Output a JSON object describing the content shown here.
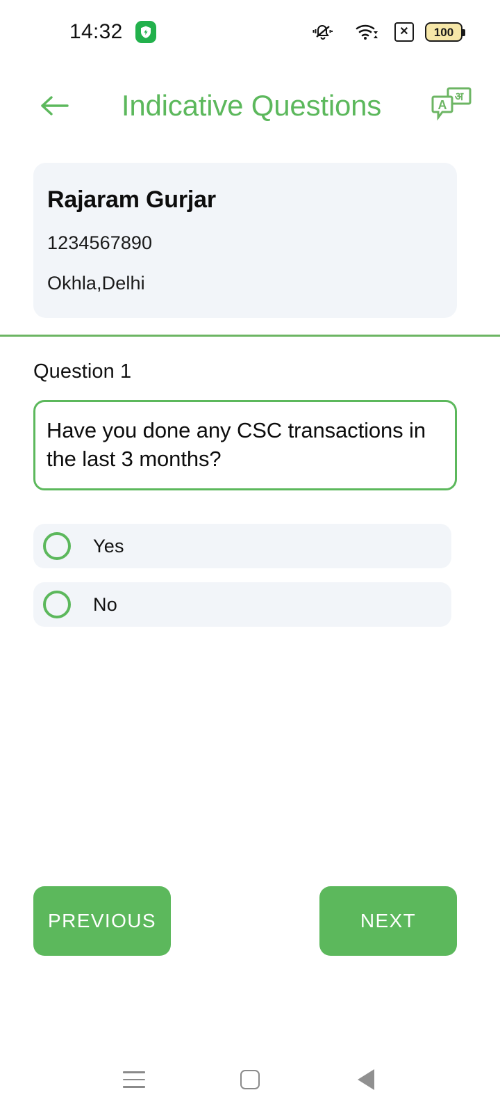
{
  "status_bar": {
    "time": "14:32",
    "shield_icon": "shield-bolt-icon",
    "mute_icon": "bell-mute-icon",
    "wifi_icon": "wifi-icon",
    "sim_icon": "no-sim-icon",
    "sim_glyph": "✕",
    "battery_level": "100"
  },
  "header": {
    "back_icon": "back-arrow-icon",
    "title": "Indicative Questions",
    "translate_icon": "translate-icon",
    "translate_glyph_front": "A",
    "translate_glyph_back": "अ",
    "accent_color": "#5cb85c"
  },
  "user_card": {
    "name": "Rajaram Gurjar",
    "phone": "1234567890",
    "location": "Okhla,Delhi",
    "background_color": "#f2f5f9"
  },
  "question": {
    "label": "Question 1",
    "text": "Have you done any CSC transactions in the last 3 months?",
    "border_color": "#5cb85c",
    "options": [
      {
        "label": "Yes",
        "selected": false
      },
      {
        "label": "No",
        "selected": false
      }
    ]
  },
  "footer": {
    "previous_label": "PREVIOUS",
    "next_label": "NEXT",
    "button_color": "#5cb85c"
  },
  "android_nav": {
    "recents_icon": "menu-icon",
    "home_icon": "home-square-icon",
    "back_icon": "back-triangle-icon"
  }
}
